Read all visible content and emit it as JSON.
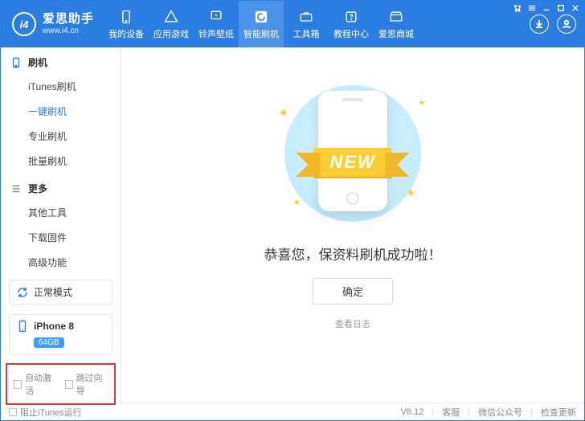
{
  "brand": {
    "name": "爱思助手",
    "url": "www.i4.cn",
    "logo_text": "i4"
  },
  "nav": [
    {
      "label": "我的设备",
      "icon": "device"
    },
    {
      "label": "应用游戏",
      "icon": "apps"
    },
    {
      "label": "铃声壁纸",
      "icon": "music"
    },
    {
      "label": "智能刷机",
      "icon": "flash",
      "active": true
    },
    {
      "label": "工具箱",
      "icon": "toolbox"
    },
    {
      "label": "教程中心",
      "icon": "help"
    },
    {
      "label": "爱思商城",
      "icon": "store"
    }
  ],
  "sidebar": {
    "group1": {
      "title": "刷机",
      "items": [
        "iTunes刷机",
        "一键刷机",
        "专业刷机",
        "批量刷机"
      ],
      "active_index": 1
    },
    "group2": {
      "title": "更多",
      "items": [
        "其他工具",
        "下载固件",
        "高级功能"
      ]
    },
    "mode": "正常模式",
    "device": {
      "name": "iPhone 8",
      "storage": "64GB"
    },
    "checks": {
      "auto_activate": "自动激活",
      "skip_guide": "跳过向导"
    }
  },
  "main": {
    "ribbon": "NEW",
    "congrats": "恭喜您，保资料刷机成功啦！",
    "ok": "确定",
    "view_log": "查看日志"
  },
  "footer": {
    "block_itunes": "阻止iTunes运行",
    "version": "V8.12",
    "support": "客服",
    "wechat": "微信公众号",
    "update": "检查更新"
  }
}
